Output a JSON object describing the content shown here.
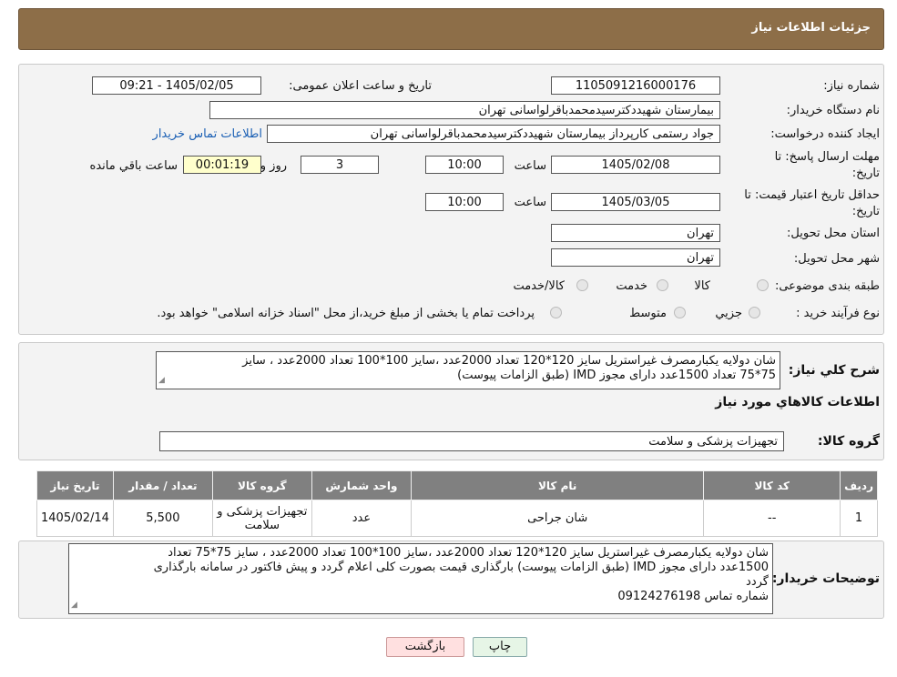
{
  "header": {
    "title": "جزئیات اطلاعات نیاز"
  },
  "form": {
    "need_number_label": "شماره نیاز:",
    "need_number": "1105091216000176",
    "announce_label": "تاریخ و ساعت اعلان عمومی:",
    "announce_value": "1405/02/05 - 09:21",
    "buyer_org_label": "نام دستگاه خریدار:",
    "buyer_org": "بیمارستان شهیددکترسیدمحمدباقرلواسانی تهران",
    "creator_label": "ایجاد کننده درخواست:",
    "creator": "جواد رستمی کارپرداز بیمارستان شهیددکترسیدمحمدباقرلواسانی تهران",
    "contact_link": "اطلاعات تماس خریدار",
    "deadline_label_1": "مهلت ارسال پاسخ: تا",
    "deadline_label_2": "تاریخ:",
    "deadline_date": "1405/02/08",
    "time_label": "ساعت",
    "deadline_time": "10:00",
    "days_value": "3",
    "days_label": "روز و",
    "remaining_value": "00:01:19",
    "remaining_label": "ساعت باقي مانده",
    "validity_label_1": "حداقل تاریخ اعتبار قیمت: تا",
    "validity_label_2": "تاریخ:",
    "validity_date": "1405/03/05",
    "validity_time": "10:00",
    "province_label": "استان محل تحویل:",
    "province": "تهران",
    "city_label": "شهر محل تحویل:",
    "city": "تهران",
    "category_label": "طبقه بندی موضوعی:",
    "category_options": [
      "کالا",
      "خدمت",
      "کالا/خدمت"
    ],
    "process_label": "نوع فرآیند خرید :",
    "process_options": [
      "جزیي",
      "متوسط"
    ],
    "process_note": "پرداخت تمام یا بخشی از مبلغ خرید،از محل \"اسناد خزانه اسلامی\" خواهد بود."
  },
  "summary": {
    "desc_label": "شرح کلي نياز:",
    "desc_line1": "شان دولایه یکبارمصرف غیراستریل سایز 120*120 تعداد 2000عدد ،سایز 100*100 تعداد 2000عدد ، سایز",
    "desc_line2": "75*75 تعداد 1500عدد دارای مجوز IMD (طبق الزامات پیوست)",
    "goods_info_title": "اطلاعات کالاهاي مورد نياز",
    "group_label": "گروه کالا:",
    "group_value": "تجهیزات پزشکی و سلامت"
  },
  "table": {
    "headers": [
      "ردیف",
      "کد کالا",
      "نام کالا",
      "واحد شمارش",
      "گروه کالا",
      "تعداد / مقدار",
      "تاریخ نیاز"
    ],
    "row": {
      "index": "1",
      "code": "--",
      "name": "شان جراحی",
      "unit": "عدد",
      "group_line1": "تجهیزات پزشکی و",
      "group_line2": "سلامت",
      "qty": "5,500",
      "date": "1405/02/14"
    }
  },
  "buyer_notes": {
    "label": "توضیحات خریدار:",
    "line1": "شان دولایه یکبارمصرف غیراستریل سایز 120*120 تعداد 2000عدد ،سایز 100*100 تعداد 2000عدد ، سایز 75*75 تعداد",
    "line2": "1500عدد دارای مجوز IMD (طبق الزامات پیوست) بارگذاری قیمت بصورت کلی اعلام گردد و پیش فاکتور در سامانه بارگذاری",
    "line3": "گردد",
    "line4": "شماره تماس 09124276198"
  },
  "buttons": {
    "print": "چاپ",
    "back": "بازگشت"
  },
  "colors": {
    "header_bg": "#8d6e48",
    "table_header_bg": "#808080",
    "back_button_bg": "#ffe0e0",
    "print_button_bg": "#e6f5e6"
  }
}
